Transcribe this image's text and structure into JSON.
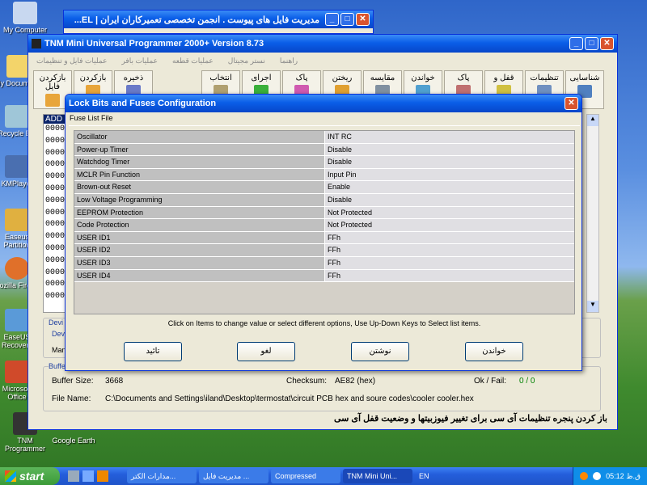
{
  "desktop": {
    "icons": [
      "My Computer",
      "My Documents",
      "Recycle Bin",
      "KMPlayer",
      "Easeus Partition",
      "Mozilla Firefox",
      "EaseUS Recovery",
      "Microsoft Office",
      "TNM Programmer",
      "Google Earth"
    ]
  },
  "browser": {
    "title": "مدیریت فایل های پیوست . انجمن تخصصی تعمیرکاران ایران | EL..."
  },
  "app": {
    "title": "TNM Mini Universal Programmer 2000+   Version 8.73",
    "menu": [
      "عملیات فایل و تنظیمات",
      "عملیات بافر",
      "عملیات قطعه",
      "نستر مجیتال",
      "راهنما"
    ],
    "toolbar": [
      "ذخیره",
      "بازکردن",
      "بازکردن فایل",
      "انتخاب",
      "اجرای",
      "پاک",
      "ریختن",
      "مقایسه",
      "خواندن",
      "پاک",
      "قفل و",
      "تنظیمات",
      "شناسایی"
    ],
    "addr_header": "ADD",
    "addr_rows": [
      "0000",
      "0000",
      "0000",
      "0000",
      "0000",
      "0000",
      "0000",
      "0000",
      "0000",
      "0000",
      "0000",
      "0000",
      "0000",
      "0000",
      "0000"
    ],
    "device_labels": [
      "Devi",
      "Devi",
      "Man"
    ],
    "buffer_group": "Buffe",
    "buffer_size_label": "Buffer Size:",
    "buffer_size": "3668",
    "checksum_label": "Checksum:",
    "checksum": "AE82 (hex)",
    "okfail_label": "Ok / Fail:",
    "okfail": "0 / 0",
    "filename_label": "File Name:",
    "filename": "C:\\Documents and Settings\\iland\\Desktop\\termostat\\circuit PCB hex and soure codes\\cooler cooler.hex",
    "hint": "باز کردن پنجره تنظیمات آی سی برای تغییر فیوزبیتها و وضعیت قفل آی سی"
  },
  "dialog": {
    "title": "Lock Bits and Fuses Configuration",
    "menu_label": "Fuse List File",
    "rows": [
      {
        "k": "Oscillator",
        "v": "INT RC"
      },
      {
        "k": "Power-up Timer",
        "v": "Disable"
      },
      {
        "k": "Watchdog Timer",
        "v": "Disable"
      },
      {
        "k": "MCLR Pin Function",
        "v": "Input Pin"
      },
      {
        "k": "Brown-out Reset",
        "v": "Enable"
      },
      {
        "k": "Low Voltage Programming",
        "v": "Disable"
      },
      {
        "k": "EEPROM Protection",
        "v": "Not Protected"
      },
      {
        "k": "Code Protection",
        "v": "Not Protected"
      },
      {
        "k": "USER ID1",
        "v": "FFh"
      },
      {
        "k": "USER ID2",
        "v": "FFh"
      },
      {
        "k": "USER ID3",
        "v": "FFh"
      },
      {
        "k": "USER ID4",
        "v": "FFh"
      }
    ],
    "instruction": "Click on Items to change value or select different options, Use Up-Down Keys to Select list items.",
    "buttons": [
      "تائید",
      "لغو",
      "نوشتن",
      "خواندن"
    ]
  },
  "taskbar": {
    "start": "start",
    "items": [
      "مدارات الکتر...",
      "مدیریت فایل ...",
      "Compressed",
      "TNM Mini Uni..."
    ],
    "lang": "EN",
    "clock": "05:12 ق.ظ"
  },
  "colors": {
    "titlebar": "#0a5ee8",
    "face": "#ece9d8",
    "taskbar": "#245edb"
  }
}
